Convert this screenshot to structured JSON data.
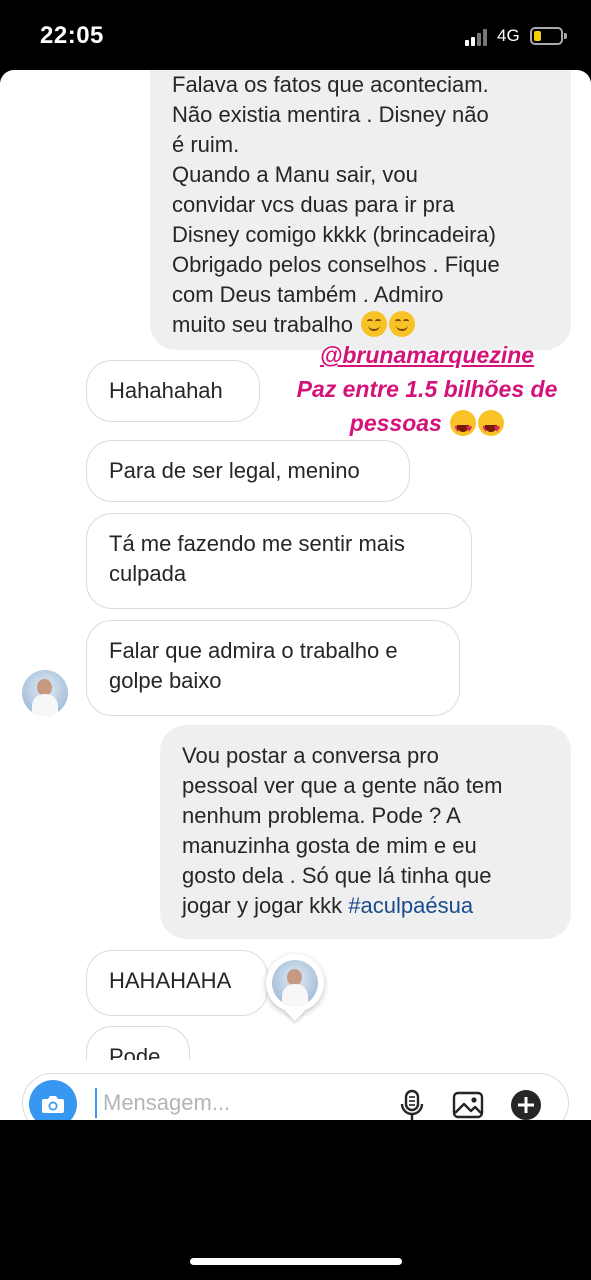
{
  "status_bar": {
    "time": "22:05",
    "network": "4G"
  },
  "messages": {
    "sent_1": {
      "lines": [
        "Falava os fatos que aconteciam.",
        "Não existia mentira .  Disney não",
        "é  ruim.",
        "Quando a Manu sair, vou",
        "convidar vcs duas para ir pra",
        "Disney comigo kkkk (brincadeira)",
        "Obrigado pelos conselhos . Fique",
        "com Deus também . Admiro",
        "muito seu trabalho"
      ]
    },
    "recv_1": "Hahahahah",
    "recv_2": "Para de ser legal, menino",
    "recv_3": {
      "line1": "Tá me fazendo me sentir mais",
      "line2": "culpada"
    },
    "recv_4": {
      "line1": "Falar que admira o trabalho e",
      "line2": "golpe baixo"
    },
    "sent_2": {
      "line1": "Vou postar a conversa pro",
      "line2": "pessoal ver que a gente não tem",
      "line3": "nenhum problema. Pode ? A",
      "line4": "manuzinha  gosta de mim e eu",
      "line5": "gosto dela . Só que lá tinha que",
      "line6_text": "jogar y jogar kkk ",
      "hashtag": "#aculpaésua"
    },
    "recv_5": "HAHAHAHA",
    "recv_6_partial": "Pode"
  },
  "overlay": {
    "mention": "@brunamarquezine",
    "line2": "Paz entre 1.5 bilhões de",
    "line3": "pessoas"
  },
  "composer": {
    "placeholder": "Mensagem..."
  },
  "colors": {
    "accent_blue": "#3897f0",
    "overlay_pink": "#d4127a",
    "hashtag": "#1a4b8c"
  },
  "icons": [
    "camera-icon",
    "microphone-icon",
    "gallery-icon",
    "plus-icon"
  ]
}
